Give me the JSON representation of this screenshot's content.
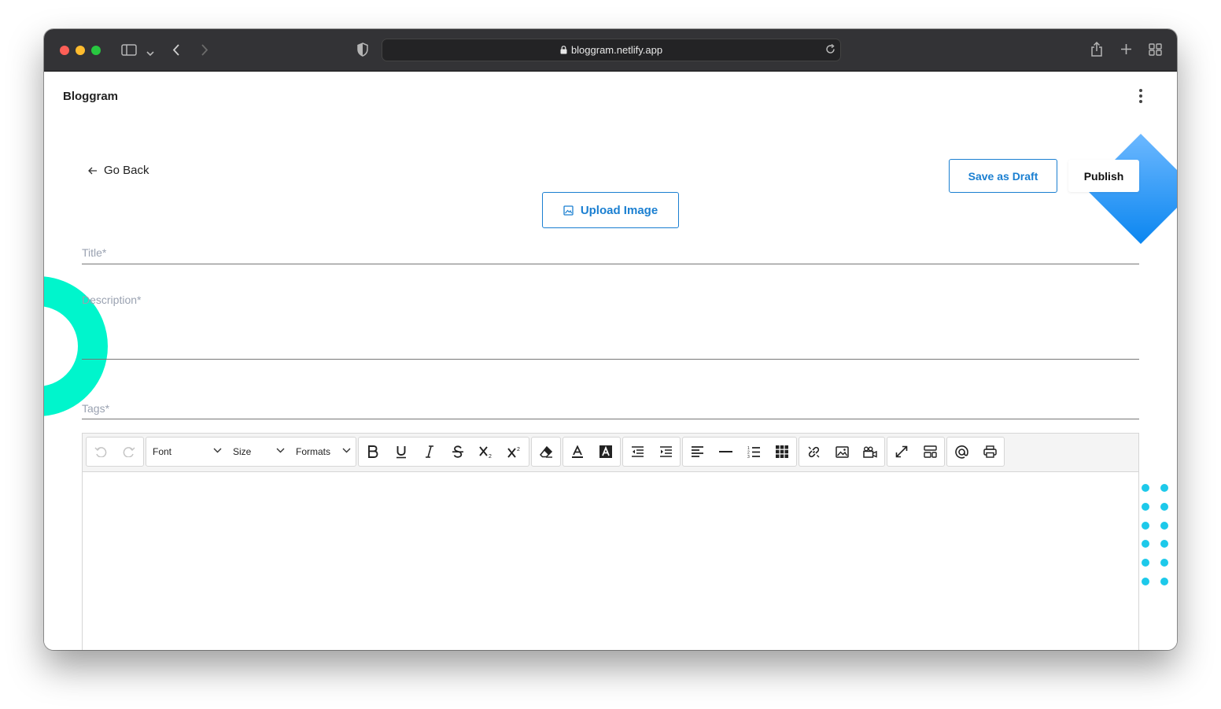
{
  "browser": {
    "url": "bloggram.netlify.app"
  },
  "header": {
    "brand": "Bloggram"
  },
  "actions": {
    "go_back": "Go Back",
    "save_draft": "Save as Draft",
    "publish": "Publish",
    "upload_image": "Upload Image"
  },
  "form": {
    "title_label": "Title*",
    "description_label": "Description*",
    "tags_label": "Tags*"
  },
  "editor": {
    "font_select": "Font",
    "size_select": "Size",
    "formats_select": "Formats"
  },
  "colors": {
    "accent": "#1a7fd1",
    "decor_teal": "#00f5cc",
    "decor_blue": "#1e8ff0",
    "decor_dots": "#1dc9ea"
  }
}
